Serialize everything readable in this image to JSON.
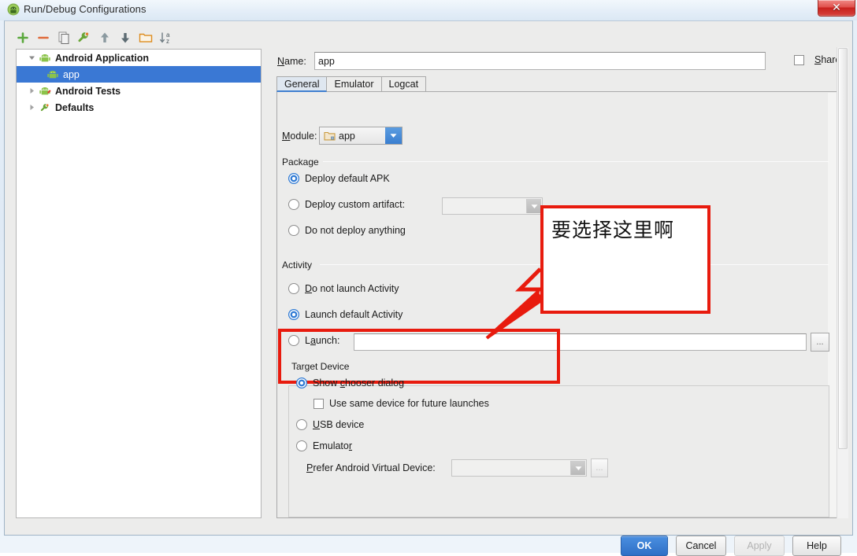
{
  "window": {
    "title": "Run/Debug Configurations",
    "title_icon": "android-icon",
    "close_label": "✕"
  },
  "toolbar": {
    "items": [
      {
        "name": "add-button",
        "icon": "plus-icon",
        "tooltip": "Add New Configuration"
      },
      {
        "name": "remove-button",
        "icon": "minus-icon",
        "tooltip": "Remove Configuration"
      },
      {
        "name": "copy-button",
        "icon": "copy-icon",
        "tooltip": "Copy Configuration"
      },
      {
        "name": "edit-defaults-button",
        "icon": "wrench-icon",
        "tooltip": "Edit defaults"
      },
      {
        "name": "move-up-button",
        "icon": "arrow-up-icon",
        "tooltip": "Move Up"
      },
      {
        "name": "move-down-button",
        "icon": "arrow-down-icon",
        "tooltip": "Move Down"
      },
      {
        "name": "create-folder-button",
        "icon": "folder-icon",
        "tooltip": "Create New Folder"
      },
      {
        "name": "sort-button",
        "icon": "sort-az-icon",
        "tooltip": "Sort Configurations"
      }
    ]
  },
  "tree": {
    "items": [
      {
        "label": "Android Application",
        "icon": "android-icon",
        "twisty": "expanded",
        "indent": 0,
        "selected": false,
        "bold": true
      },
      {
        "label": "app",
        "icon": "android-icon",
        "twisty": "none",
        "indent": 1,
        "selected": true,
        "bold": false
      },
      {
        "label": "Android Tests",
        "icon": "android-test-icon",
        "twisty": "collapsed",
        "indent": 0,
        "selected": false,
        "bold": true
      },
      {
        "label": "Defaults",
        "icon": "wrench-icon",
        "twisty": "collapsed",
        "indent": 0,
        "selected": false,
        "bold": true
      }
    ]
  },
  "form": {
    "name_label": "Name:",
    "name_value": "app",
    "share_label": "Share",
    "share_checked": false,
    "tabs": [
      {
        "label": "General",
        "active": true
      },
      {
        "label": "Emulator",
        "active": false
      },
      {
        "label": "Logcat",
        "active": false
      }
    ],
    "module_label": "Module:",
    "module_value": "app",
    "module_icon": "module-folder-icon",
    "package_group": "Package",
    "package_options": [
      {
        "label": "Deploy default APK",
        "selected": true
      },
      {
        "label": "Deploy custom artifact:",
        "selected": false
      },
      {
        "label": "Do not deploy anything",
        "selected": false
      }
    ],
    "artifact_value": "",
    "activity_group": "Activity",
    "activity_options": [
      {
        "label": "Do not launch Activity",
        "selected": false
      },
      {
        "label": "Launch default Activity",
        "selected": true
      },
      {
        "label": "Launch:",
        "selected": false
      }
    ],
    "launch_value": "",
    "launch_browse_label": "...",
    "target_group": "Target Device",
    "target_options": [
      {
        "label": "Show chooser dialog",
        "selected": true
      },
      {
        "label": "USB device",
        "selected": false
      },
      {
        "label": "Emulator",
        "selected": false
      }
    ],
    "use_same_device_label": "Use same device for future launches",
    "use_same_device_checked": false,
    "avd_label": "Prefer Android Virtual Device:",
    "avd_value": "",
    "avd_browse_label": "...",
    "avd_disabled": true
  },
  "buttons": [
    {
      "label": "OK",
      "style": "primary"
    },
    {
      "label": "Cancel",
      "style": "normal"
    },
    {
      "label": "Apply",
      "style": "disabled"
    },
    {
      "label": "Help",
      "style": "normal"
    }
  ],
  "annotation": {
    "callout_text": "要选择这里啊",
    "color": "#e81b0e"
  }
}
